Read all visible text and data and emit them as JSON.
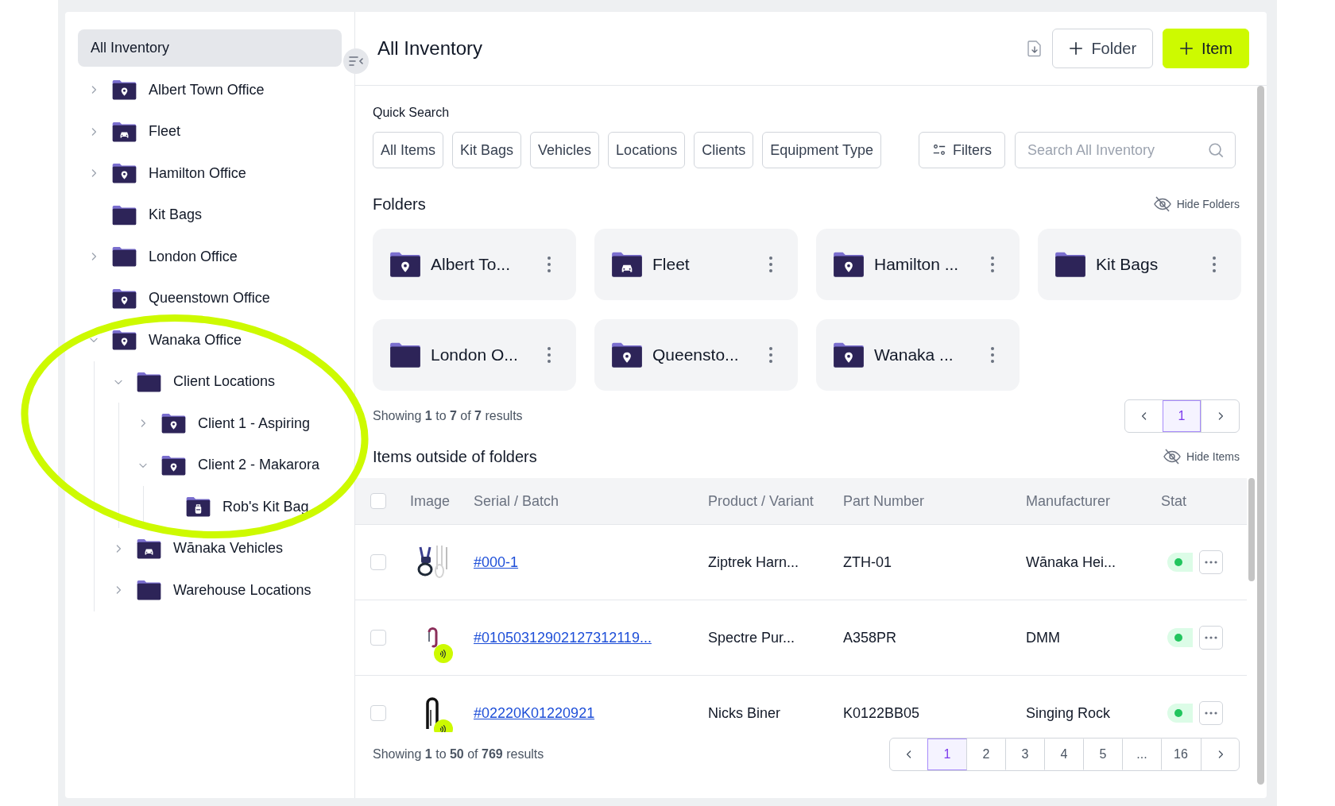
{
  "sidebar": {
    "root": {
      "label": "All Inventory",
      "selected": true
    },
    "tree": [
      {
        "label": "Albert Town Office",
        "kind": "location",
        "expandable": true,
        "expanded": false,
        "selected": false
      },
      {
        "label": "Fleet",
        "kind": "vehicle",
        "expandable": true,
        "expanded": false,
        "selected": false
      },
      {
        "label": "Hamilton Office",
        "kind": "location",
        "expandable": true,
        "expanded": false,
        "selected": false
      },
      {
        "label": "Kit Bags",
        "kind": "plain",
        "expandable": false,
        "expanded": false,
        "selected": false
      },
      {
        "label": "London Office",
        "kind": "plain",
        "expandable": true,
        "expanded": false,
        "selected": false
      },
      {
        "label": "Queenstown Office",
        "kind": "location",
        "expandable": false,
        "expanded": false,
        "selected": false
      },
      {
        "label": "Wanaka Office",
        "kind": "location",
        "expandable": true,
        "expanded": true,
        "selected": false,
        "children": [
          {
            "label": "Client Locations",
            "kind": "plain",
            "expandable": true,
            "expanded": true,
            "selected": false,
            "children": [
              {
                "label": "Client 1 - Aspiring",
                "kind": "location",
                "expandable": true,
                "expanded": false,
                "selected": false
              },
              {
                "label": "Client 2 - Makarora",
                "kind": "location",
                "expandable": true,
                "expanded": true,
                "selected": false,
                "children": [
                  {
                    "label": "Rob's Kit Bag",
                    "kind": "kit",
                    "expandable": false,
                    "expanded": false,
                    "selected": false
                  }
                ]
              }
            ]
          },
          {
            "label": "Wānaka Vehicles",
            "kind": "vehicle",
            "expandable": true,
            "expanded": false,
            "selected": false
          },
          {
            "label": "Warehouse Locations",
            "kind": "plain",
            "expandable": true,
            "expanded": false,
            "selected": false
          }
        ]
      }
    ]
  },
  "header": {
    "title": "All Inventory",
    "buttons": [
      {
        "label": "Folder",
        "kind": "secondary"
      },
      {
        "label": "Item",
        "kind": "primary"
      }
    ]
  },
  "quick_search": {
    "label": "Quick Search",
    "chips": [
      "All Items",
      "Kit Bags",
      "Vehicles",
      "Locations",
      "Clients",
      "Equipment Type"
    ],
    "filters": "Filters",
    "search": {
      "placeholder": "Search All Inventory"
    }
  },
  "folders": {
    "title": "Folders",
    "toggle": "Hide Folders",
    "cards": [
      {
        "label": "Albert To...",
        "kind": "location"
      },
      {
        "label": "Fleet",
        "kind": "vehicle"
      },
      {
        "label": "Hamilton ...",
        "kind": "location"
      },
      {
        "label": "Kit Bags",
        "kind": "plain"
      },
      {
        "label": "London O...",
        "kind": "plain"
      },
      {
        "label": "Queensto...",
        "kind": "location"
      },
      {
        "label": "Wanaka ...",
        "kind": "location"
      }
    ],
    "summary": "Showing **1** to **7** of **7** results",
    "pages": [
      {
        "label": "1",
        "selected": true
      }
    ]
  },
  "items": {
    "title": "Items outside of folders",
    "toggle": "Hide Items",
    "select_all": {
      "checked": false
    },
    "columns": [
      "Image",
      "Serial / Batch",
      "Product / Variant",
      "Part Number",
      "Manufacturer",
      "Stat"
    ],
    "rows": [
      {
        "kind": "harness",
        "checked": false,
        "tagged": false,
        "serial": "#000-1",
        "product": "Ziptrek Harn...",
        "part": "ZTH-01",
        "manufacturer": "Wānaka Hei..."
      },
      {
        "kind": "carabiner",
        "checked": false,
        "tagged": true,
        "serial": "#01050312902127312119...",
        "product": "Spectre Pur...",
        "part": "A358PR",
        "manufacturer": "DMM"
      },
      {
        "kind": "biner",
        "checked": false,
        "tagged": true,
        "serial": "#02220K01220921",
        "product": "Nicks Biner",
        "part": "K0122BB05",
        "manufacturer": "Singing Rock"
      }
    ],
    "summary": "Showing **1** to **50** of **769** results",
    "pages": [
      {
        "label": "1",
        "selected": true
      },
      {
        "label": "2",
        "selected": false
      },
      {
        "label": "3",
        "selected": false
      },
      {
        "label": "4",
        "selected": false
      },
      {
        "label": "5",
        "selected": false
      },
      {
        "label": "...",
        "selected": false
      },
      {
        "label": "16",
        "selected": false
      }
    ]
  }
}
